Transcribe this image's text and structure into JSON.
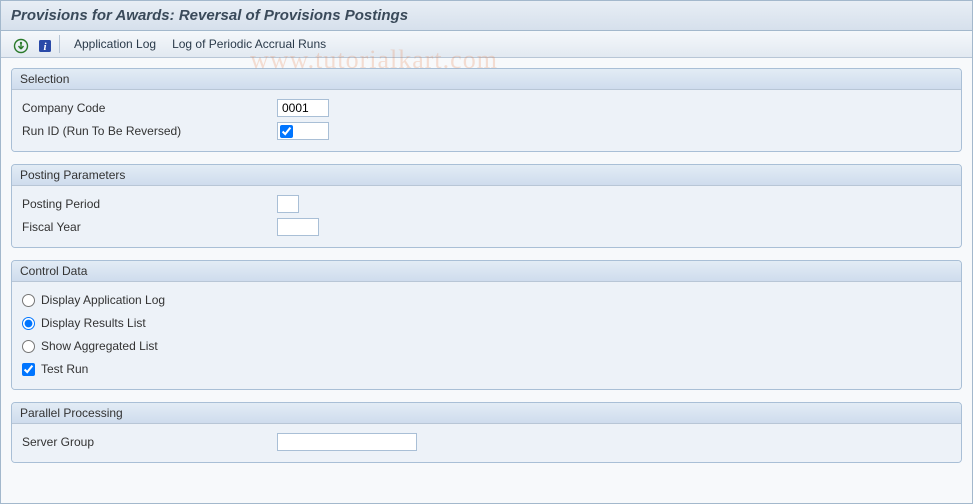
{
  "title": "Provisions for Awards: Reversal of Provisions Postings",
  "toolbar": {
    "app_log": "Application Log",
    "periodic_log": "Log of Periodic Accrual Runs"
  },
  "watermark": "www.tutorialkart.com",
  "groups": {
    "selection": {
      "title": "Selection",
      "company_code_label": "Company Code",
      "company_code_value": "0001",
      "run_id_label": "Run ID (Run To Be Reversed)",
      "run_id_checked": true
    },
    "posting": {
      "title": "Posting Parameters",
      "posting_period_label": "Posting Period",
      "posting_period_value": "",
      "fiscal_year_label": "Fiscal Year",
      "fiscal_year_value": ""
    },
    "control": {
      "title": "Control Data",
      "opt_app_log": "Display Application Log",
      "opt_results": "Display Results List",
      "opt_aggregated": "Show Aggregated List",
      "chk_test_run": "Test Run",
      "selected_option": "results",
      "test_run_checked": true
    },
    "parallel": {
      "title": "Parallel Processing",
      "server_group_label": "Server Group",
      "server_group_value": ""
    }
  }
}
